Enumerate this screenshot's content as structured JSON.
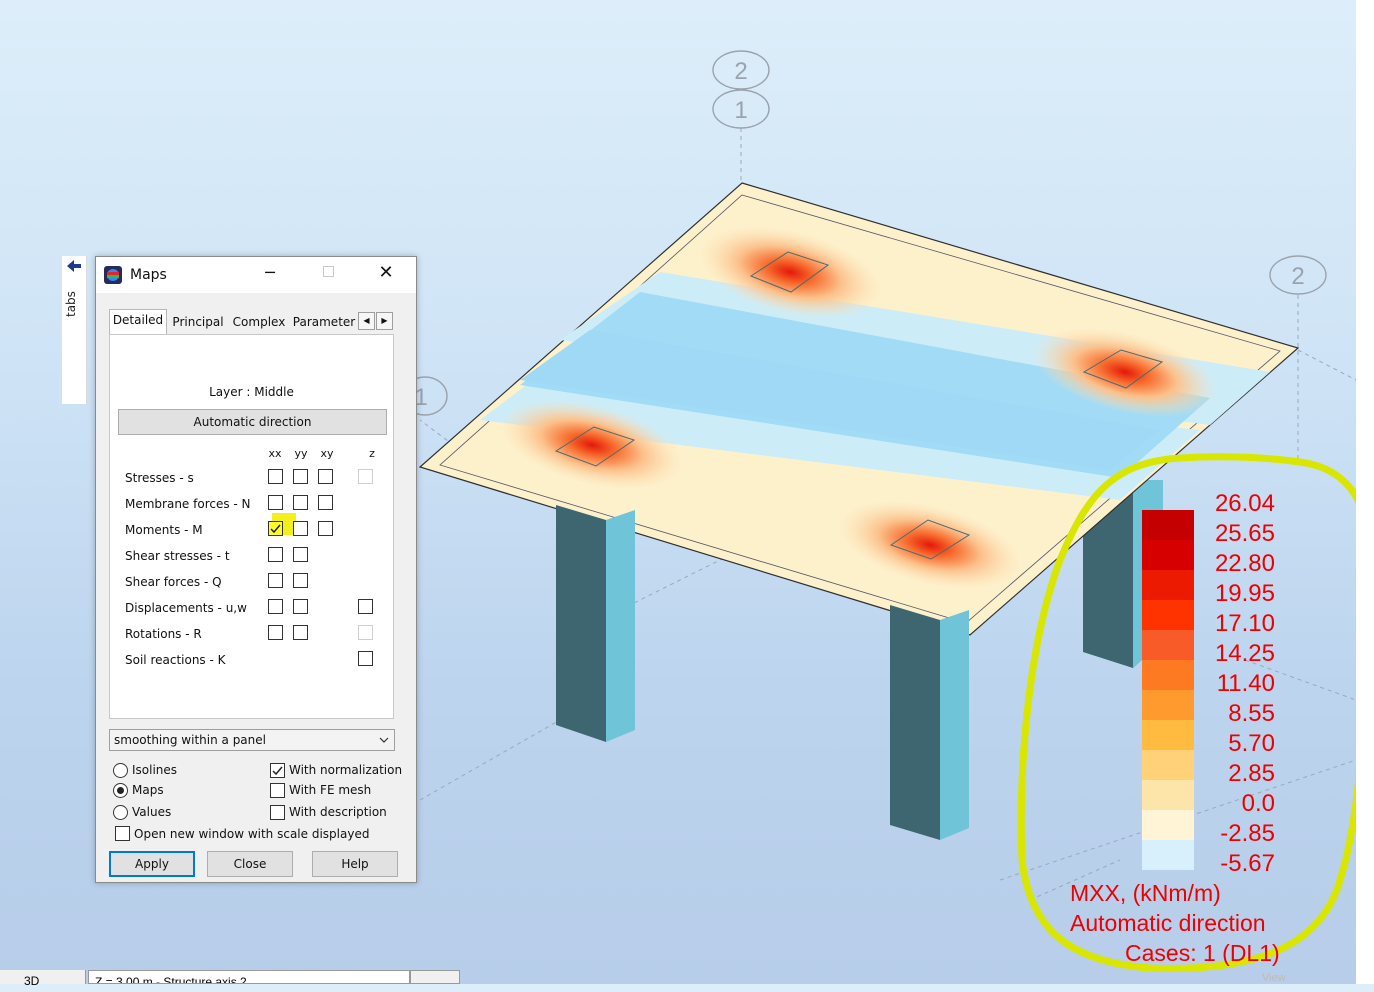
{
  "window": {
    "title": "Maps",
    "min_glyph": "─",
    "close_glyph": "✕"
  },
  "side_tabs": {
    "label": "tabs"
  },
  "tabs": [
    {
      "label": "Detailed",
      "active": true
    },
    {
      "label": "Principal",
      "active": false
    },
    {
      "label": "Complex",
      "active": false
    },
    {
      "label": "Parameter",
      "active": false
    }
  ],
  "tab_scroll": {
    "left": "◀",
    "right": "▶"
  },
  "layer": "Layer : Middle",
  "automatic_direction_button": "Automatic direction",
  "columns": [
    "xx",
    "yy",
    "xy",
    "z"
  ],
  "rows": [
    {
      "label": "Stresses - s"
    },
    {
      "label": "Membrane forces - N"
    },
    {
      "label": "Moments - M",
      "checked": "xx"
    },
    {
      "label": "Shear stresses - t"
    },
    {
      "label": "Shear forces - Q"
    },
    {
      "label": "Displacements - u,w"
    },
    {
      "label": "Rotations - R"
    },
    {
      "label": "Soil reactions - K"
    }
  ],
  "smoothing": {
    "value": "smoothing within a panel"
  },
  "options": {
    "isolines": "Isolines",
    "maps": "Maps",
    "values": "Values",
    "selected": "Maps",
    "with_normalization": "With normalization",
    "with_fe_mesh": "With FE mesh",
    "with_description": "With description",
    "open_new_window": "Open new window with scale displayed"
  },
  "buttons": {
    "apply": "Apply",
    "close": "Close",
    "help": "Help"
  },
  "axis_bubbles": {
    "top_back": "2",
    "top_front": "1",
    "right": "2",
    "left": "1"
  },
  "legend": {
    "values": [
      "26.04",
      "25.65",
      "22.80",
      "19.95",
      "17.10",
      "14.25",
      "11.40",
      "8.55",
      "5.70",
      "2.85",
      "0.0",
      "-2.85",
      "-5.67"
    ],
    "colors": [
      "#c40000",
      "#d70000",
      "#ec1a00",
      "#ff3300",
      "#f85a28",
      "#fe7a22",
      "#ff9a2e",
      "#ffba40",
      "#ffd27a",
      "#fde4a8",
      "#fff5d6",
      "#d8f0fb",
      "#9fdcf7"
    ],
    "title": "MXX, (kNm/m)",
    "direction": "Automatic direction",
    "cases": "Cases: 1 (DL1)",
    "text_color": "#ee0000"
  },
  "highlight_color": "#d8e600",
  "status_bar": {
    "mode": "3D",
    "level": "Z = 3.00 m - Structure axis 2",
    "view": "View"
  }
}
